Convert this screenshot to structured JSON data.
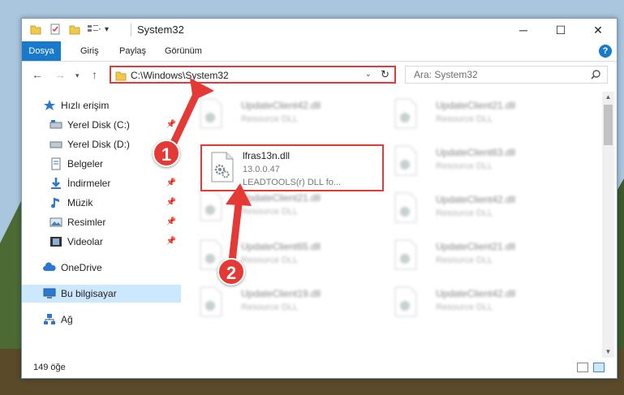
{
  "window": {
    "title": "System32"
  },
  "ribbon": {
    "tabs": [
      "Dosya",
      "Giriş",
      "Paylaş",
      "Görünüm"
    ]
  },
  "address": {
    "path": "C:\\Windows\\System32"
  },
  "search": {
    "placeholder": "Ara: System32"
  },
  "sidebar": {
    "items": [
      {
        "label": "Hızlı erişim",
        "icon": "star-icon"
      },
      {
        "label": "Yerel Disk (C:)",
        "icon": "drive-icon",
        "pinned": true
      },
      {
        "label": "Yerel Disk (D:)",
        "icon": "drive-icon",
        "pinned": true
      },
      {
        "label": "Belgeler",
        "icon": "documents-icon",
        "pinned": true
      },
      {
        "label": "İndirmeler",
        "icon": "downloads-icon",
        "pinned": true
      },
      {
        "label": "Müzik",
        "icon": "music-icon",
        "pinned": true
      },
      {
        "label": "Resimler",
        "icon": "pictures-icon",
        "pinned": true
      },
      {
        "label": "Videolar",
        "icon": "videos-icon",
        "pinned": true
      },
      {
        "label": "OneDrive",
        "icon": "cloud-icon"
      },
      {
        "label": "Bu bilgisayar",
        "icon": "computer-icon",
        "selected": true
      },
      {
        "label": "Ağ",
        "icon": "network-icon"
      }
    ]
  },
  "files": [
    {
      "name": "UpdateClient42.dll",
      "desc": "Resource DLL"
    },
    {
      "name": "UpdateClient21.dll",
      "desc": "Resource DLL"
    },
    {
      "name": "UpdateClient63.dll",
      "desc": "Resource DLL"
    },
    {
      "name": "UpdateClient21.dll",
      "desc": "Resource DLL"
    },
    {
      "name": "UpdateClient42.dll",
      "desc": "Resource DLL"
    },
    {
      "name": "UpdateClient65.dll",
      "desc": "Resource DLL"
    },
    {
      "name": "UpdateClient21.dll",
      "desc": "Resource DLL"
    },
    {
      "name": "UpdateClient19.dll",
      "desc": "Resource DLL"
    },
    {
      "name": "UpdateClient42.dll",
      "desc": "Resource DLL"
    }
  ],
  "highlighted_file": {
    "name": "lfras13n.dll",
    "version": "13.0.0.47",
    "company": "LEADTOOLS(r) DLL fo..."
  },
  "status": {
    "count": "149 öğe"
  },
  "callouts": [
    "1",
    "2"
  ],
  "colors": {
    "accent": "#1979ca",
    "highlight": "#e53935",
    "selected": "#cce8ff"
  }
}
